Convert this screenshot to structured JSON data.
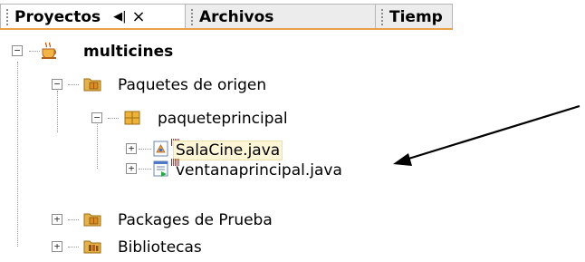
{
  "tabs": [
    {
      "label": "Proyectos",
      "pin": "◀|",
      "close": "×",
      "active": true
    },
    {
      "label": "Archivos",
      "active": false
    },
    {
      "label": "Tiemp",
      "active": false
    }
  ],
  "tree": {
    "root": {
      "label": "multicines",
      "icon": "coffee-cup-icon"
    },
    "source_packages": {
      "label": "Paquetes de origen",
      "icon": "package-folder-icon"
    },
    "main_package": {
      "label": "paqueteprincipal",
      "icon": "package-icon"
    },
    "file_salacine": {
      "label": "SalaCine.java",
      "icon": "java-class-icon"
    },
    "file_ventana": {
      "label": "ventanaprincipal.java",
      "icon": "java-form-icon"
    },
    "test_packages": {
      "label": "Packages de Prueba",
      "icon": "package-folder-icon"
    },
    "libraries": {
      "label": "Bibliotecas",
      "icon": "library-folder-icon"
    }
  },
  "colors": {
    "tab_underline": "#e8a04a",
    "selection_bg": "#fdf6d6",
    "badge": "#c00000",
    "folder": "#e4b24a"
  }
}
